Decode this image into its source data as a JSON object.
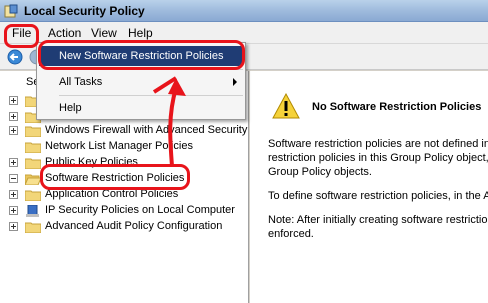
{
  "window": {
    "title": "Local Security Policy"
  },
  "menubar": {
    "items": [
      "File",
      "Action",
      "View",
      "Help"
    ]
  },
  "action_menu": {
    "items": [
      {
        "label": "New Software Restriction Policies",
        "selected": true
      },
      {
        "label": "All Tasks",
        "submenu": true
      },
      {
        "label": "Help"
      }
    ]
  },
  "tree": {
    "partial_top_label": "Se",
    "items": [
      {
        "label": "Windows Firewall with Advanced Security",
        "expander": "plus"
      },
      {
        "label": "Network List Manager Policies",
        "expander": "none"
      },
      {
        "label": "Public Key Policies",
        "expander": "plus"
      },
      {
        "label": "Software Restriction Policies",
        "expander": "minus"
      },
      {
        "label": "Application Control Policies",
        "expander": "plus"
      },
      {
        "label": "IP Security Policies on Local Computer",
        "expander": "plus"
      },
      {
        "label": "Advanced Audit Policy Configuration",
        "expander": "plus"
      }
    ]
  },
  "details": {
    "header": "No Software Restriction Policies",
    "para1": [
      "Software restriction policies are not defined in",
      "restriction policies in this Group Policy object, t",
      "Group Policy objects."
    ],
    "para2": "To define software restriction policies, in the A",
    "para3": [
      "Note: After initially creating software restrictio",
      "enforced."
    ]
  },
  "colors": {
    "annotation": "#e8141b",
    "menu_highlight": "#1f3c74"
  }
}
